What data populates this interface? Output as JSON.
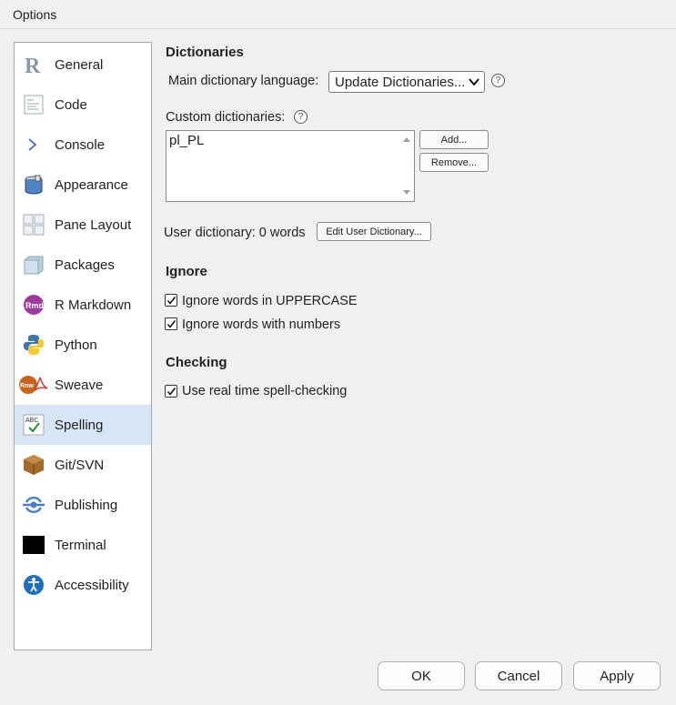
{
  "window": {
    "title": "Options"
  },
  "sidebar": {
    "items": [
      {
        "label": "General"
      },
      {
        "label": "Code"
      },
      {
        "label": "Console"
      },
      {
        "label": "Appearance"
      },
      {
        "label": "Pane Layout"
      },
      {
        "label": "Packages"
      },
      {
        "label": "R Markdown"
      },
      {
        "label": "Python"
      },
      {
        "label": "Sweave"
      },
      {
        "label": "Spelling"
      },
      {
        "label": "Git/SVN"
      },
      {
        "label": "Publishing"
      },
      {
        "label": "Terminal"
      },
      {
        "label": "Accessibility"
      }
    ],
    "selected": "Spelling"
  },
  "icons": {
    "general": "r-logo-icon",
    "code": "code-document-icon",
    "console": "console-prompt-icon",
    "appearance": "paint-bucket-icon",
    "pane_layout": "pane-grid-icon",
    "packages": "package-box-icon",
    "rmarkdown": "rmd-icon",
    "python": "python-icon",
    "sweave": "sweave-pdf-icon",
    "spelling": "abc-check-icon",
    "git": "git-box-icon",
    "publishing": "publish-icon",
    "terminal": "terminal-icon",
    "accessibility": "accessibility-icon"
  },
  "dictionaries": {
    "heading": "Dictionaries",
    "main_language_label": "Main dictionary language:",
    "main_language_value": "Update Dictionaries...",
    "custom_label": "Custom dictionaries:",
    "custom_items": [
      "pl_PL"
    ],
    "add_label": "Add...",
    "remove_label": "Remove...",
    "user_dictionary_label": "User dictionary: 0 words",
    "edit_user_dictionary_label": "Edit User Dictionary..."
  },
  "ignore": {
    "heading": "Ignore",
    "uppercase_label": "Ignore words in UPPERCASE",
    "uppercase_checked": true,
    "numbers_label": "Ignore words with numbers",
    "numbers_checked": true
  },
  "checking": {
    "heading": "Checking",
    "realtime_label": "Use real time spell-checking",
    "realtime_checked": true
  },
  "footer": {
    "ok_label": "OK",
    "cancel_label": "Cancel",
    "apply_label": "Apply"
  },
  "help": {
    "glyph": "?"
  },
  "colors": {
    "selected_bg": "#d6e6f5",
    "rmd": "#9c3b9f",
    "sweave": "#c8641e",
    "python_blue": "#3d77a8",
    "python_yellow": "#f6c932"
  }
}
